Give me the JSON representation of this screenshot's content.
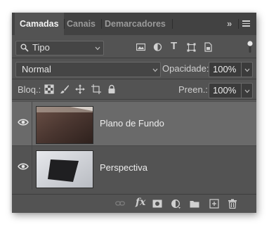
{
  "tabs": [
    {
      "label": "Camadas",
      "active": true
    },
    {
      "label": "Canais",
      "active": false
    },
    {
      "label": "Demarcadores",
      "active": false
    }
  ],
  "header": {
    "collapse_label": "»",
    "menu_icon": "hamburger-menu-icon"
  },
  "filter": {
    "kind_label": "Tipo",
    "icons": [
      "pixel-layer-filter-icon",
      "adjustment-layer-filter-icon",
      "type-layer-filter-icon",
      "shape-layer-filter-icon",
      "smart-object-filter-icon"
    ],
    "type_glyph": "T"
  },
  "blend": {
    "mode": "Normal"
  },
  "opacity": {
    "label": "Opacidade:",
    "value": "100%"
  },
  "lock": {
    "label": "Bloq.:"
  },
  "fill": {
    "label": "Preen.:",
    "value": "100%"
  },
  "layers": [
    {
      "name": "Plano de Fundo",
      "visible": true,
      "selected": true
    },
    {
      "name": "Perspectiva",
      "visible": true,
      "selected": false
    }
  ],
  "footer_icons": [
    "link-icon",
    "fx-icon",
    "mask-icon",
    "adjustment-icon",
    "folder-icon",
    "new-layer-icon",
    "trash-icon"
  ],
  "footer": {
    "fx_label": "fx"
  },
  "colors": {
    "panel": "#535353",
    "tabbar": "#424242",
    "selected_row": "#6a6a6a",
    "text": "#ededed"
  }
}
